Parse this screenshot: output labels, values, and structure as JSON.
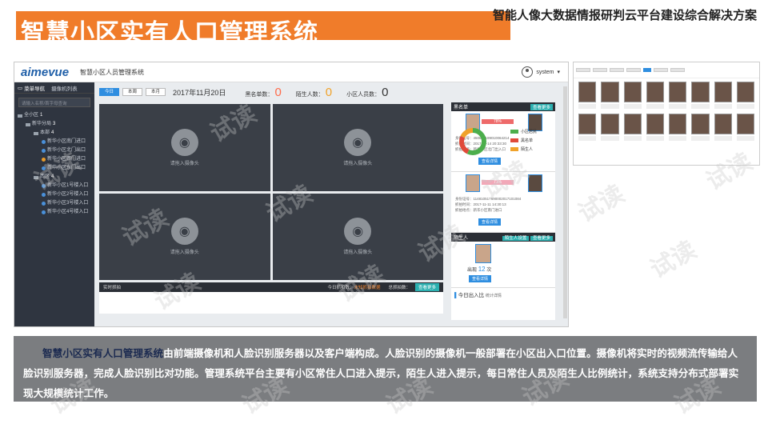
{
  "header": {
    "title": "智慧小区实有人口管理系统",
    "subtitle": "智能人像大数据情报研判云平台建设综合解决方案"
  },
  "app": {
    "logo": "aimevue",
    "name": "智慧小区人员管理系统",
    "user": "system"
  },
  "sidebar": {
    "tabs": [
      "菜单导航",
      "摄像机列表"
    ],
    "search_placeholder": "请输入名称/首字母查询",
    "tree": [
      {
        "label": "全小区",
        "count": "1",
        "type": "folder",
        "level": 0
      },
      {
        "label": "新华分局",
        "count": "3",
        "type": "folder",
        "level": 1
      },
      {
        "label": "本部",
        "count": "4",
        "type": "folder",
        "level": 2
      },
      {
        "label": "新华小区南门进口",
        "count": "",
        "type": "cam",
        "level": 3
      },
      {
        "label": "新华小区北门出口",
        "count": "",
        "type": "cam",
        "level": 3
      },
      {
        "label": "新华小区西门进口",
        "count": "",
        "type": "cam-warn",
        "level": 3
      },
      {
        "label": "新华小区东门出口",
        "count": "",
        "type": "cam",
        "level": 3
      },
      {
        "label": "西区",
        "count": "4",
        "type": "folder",
        "level": 2
      },
      {
        "label": "新华小区1号楼入口",
        "count": "",
        "type": "cam",
        "level": 3
      },
      {
        "label": "新华小区2号楼入口",
        "count": "",
        "type": "cam",
        "level": 3
      },
      {
        "label": "新华小区3号楼入口",
        "count": "",
        "type": "cam",
        "level": 3
      },
      {
        "label": "新华小区4号楼入口",
        "count": "",
        "type": "cam",
        "level": 3
      }
    ]
  },
  "toolbar": {
    "buttons": [
      "今日",
      "本周",
      "本月"
    ],
    "date": "2017年11月20日",
    "stats": [
      {
        "label": "黑名单数：",
        "value": "0",
        "color": "#ff6b4a"
      },
      {
        "label": "陌生人数：",
        "value": "0",
        "color": "#f0a22a"
      },
      {
        "label": "小区人员数：",
        "value": "0",
        "color": "#333333"
      }
    ]
  },
  "cameras": [
    {
      "label": "请拖入摄像头"
    },
    {
      "label": "请拖入摄像头"
    },
    {
      "label": "请拖入摄像头"
    },
    {
      "label": "请拖入摄像头"
    }
  ],
  "bottom_bar": {
    "left": "实时抓拍",
    "today": "今日抓拍数：",
    "today_value": "未知抓拍数据",
    "total": "总抓拍数：",
    "btn": "查看更多"
  },
  "right_panel": {
    "blacklist_title": "黑名单",
    "blacklist_btn": "查看更多",
    "matches": [
      {
        "pct": "78%",
        "lines": [
          "身份证号：450603199010064214",
          "抓拍时间：2017-11-14 20:33:30",
          "抓拍地点：新华小区北门出入口"
        ],
        "btn": "查看详情"
      },
      {
        "pct": "71%",
        "lines": [
          "身份证号：114810517690002017101084",
          "抓拍时间：2017-11-11 14:30:13",
          "抓拍地点：新华小区南门进口"
        ],
        "btn": "查看详情"
      }
    ],
    "stranger_title": "陌生人",
    "stranger_btn1": "陌生人设置",
    "stranger_btn2": "查看更多",
    "stranger_count_label": "出现",
    "stranger_count": "12",
    "stranger_count_unit": "次",
    "stranger_detail": "查看详情",
    "chart_title": "今日出入比",
    "chart_sub": "统计详情",
    "legend": [
      {
        "label": "小区居民",
        "color": "#4cae4c"
      },
      {
        "label": "黑名单",
        "color": "#e04a3a"
      },
      {
        "label": "陌生人",
        "color": "#f0a22a"
      }
    ]
  },
  "description": {
    "highlight": "智慧小区实有人口管理系统",
    "text": "由前端摄像机和人脸识别服务器以及客户端构成。人脸识别的摄像机一般部署在小区出入口位置。摄像机将实时的视频流传输给人脸识别服务器，完成人脸识别比对功能。管理系统平台主要有小区常住人口进入提示，陌生人进入提示，每日常住人员及陌生人比例统计，系统支持分布式部署实现大规模统计工作。"
  },
  "watermark": "试读"
}
